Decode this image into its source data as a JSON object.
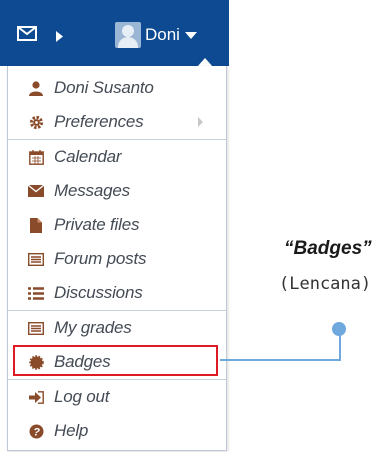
{
  "navbar": {
    "user_name": "Doni",
    "background": "#0e4a91",
    "icons": [
      "envelope-icon",
      "caret-right-icon",
      "user-avatar",
      "caret-down-icon"
    ]
  },
  "menu": {
    "items": [
      {
        "label": "Doni Susanto",
        "icon": "user-icon"
      },
      {
        "label": "Preferences",
        "icon": "cog-icon"
      },
      {
        "label": "Calendar",
        "icon": "calendar-icon"
      },
      {
        "label": "Messages",
        "icon": "envelope-icon"
      },
      {
        "label": "Private files",
        "icon": "file-icon"
      },
      {
        "label": "Forum posts",
        "icon": "list-alt-icon"
      },
      {
        "label": "Discussions",
        "icon": "list-icon"
      },
      {
        "label": "My grades",
        "icon": "list-alt-icon"
      },
      {
        "label": "Badges",
        "icon": "certificate-icon"
      },
      {
        "label": "Log out",
        "icon": "sign-out-icon"
      },
      {
        "label": "Help",
        "icon": "question-circle-icon"
      }
    ],
    "highlighted": "Badges"
  },
  "callout": {
    "title": "“Badges”",
    "subtitle": "(Lencana)",
    "highlight_color": "#e01a22",
    "line_color": "#6fa8dc"
  }
}
